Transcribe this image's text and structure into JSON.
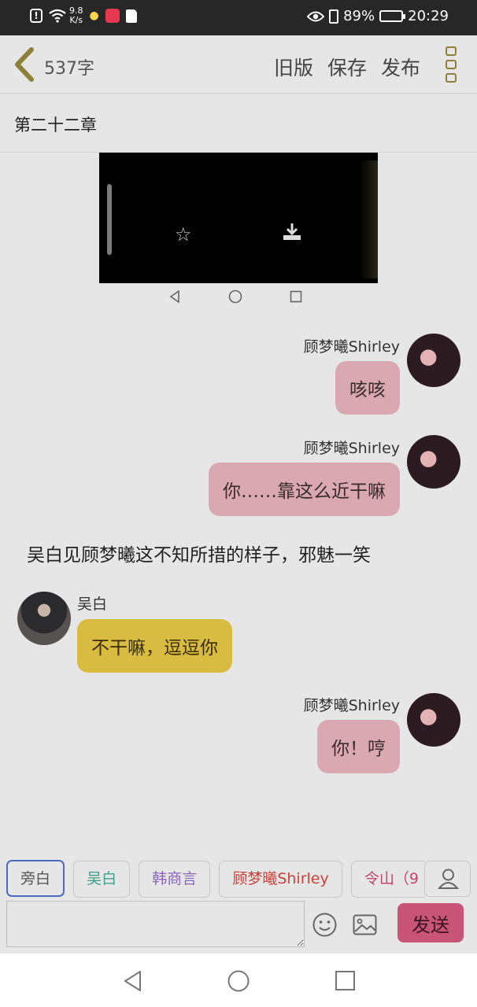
{
  "status_bar": {
    "net_speed_value": "9.8",
    "net_speed_unit": "K/s",
    "battery": "89%",
    "battery_level": 0.89,
    "time": "20:29"
  },
  "header": {
    "word_count": "537字",
    "actions": [
      "旧版",
      "保存",
      "发布"
    ]
  },
  "chapter_title": "第二十二章",
  "messages": [
    {
      "speaker": "顾梦曦Shirley",
      "text": "咳咳"
    },
    {
      "speaker": "顾梦曦Shirley",
      "text": "你……靠这么近干嘛"
    },
    {
      "narration": "吴白见顾梦曦这不知所措的样子，邪魅一笑"
    },
    {
      "speaker": "吴白",
      "text": "不干嘛，逗逗你"
    },
    {
      "speaker": "顾梦曦Shirley",
      "text": "你！哼"
    }
  ],
  "characters": [
    {
      "label": "旁白",
      "color": "#555555"
    },
    {
      "label": "吴白",
      "color": "#3aa08a"
    },
    {
      "label": "韩商言",
      "color": "#8a66b8"
    },
    {
      "label": "顾梦曦Shirley",
      "color": "#c9423c"
    },
    {
      "label": "令山（9",
      "color": "#c24670"
    }
  ],
  "composer": {
    "input_value": "",
    "send_label": "发送"
  },
  "colors": {
    "accent_gold": "#8d8038",
    "send_pink": "#c9547a",
    "bubble_pink": "#d9a8b1",
    "bubble_yellow": "#d8bc42"
  }
}
